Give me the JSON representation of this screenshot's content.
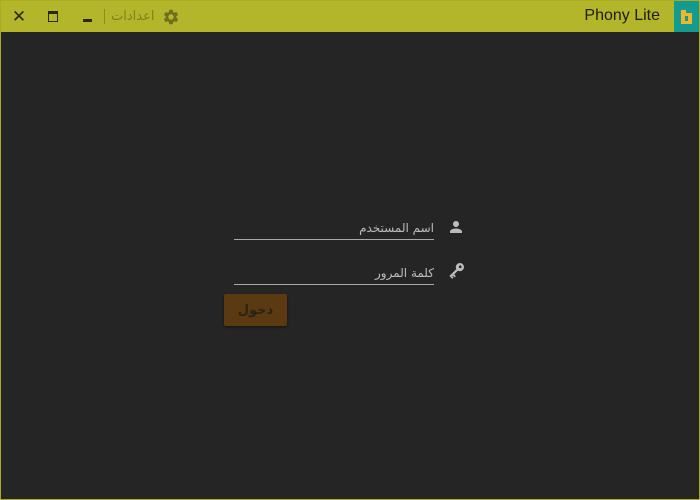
{
  "window": {
    "title": "Phony Lite",
    "settings_label": "اعدادات",
    "controls": {
      "close": "close-icon",
      "maximize": "maximize-icon",
      "minimize": "minimize-icon"
    },
    "logo_icon": "sim-card-icon"
  },
  "login": {
    "username_placeholder": "اسم المستخدم",
    "password_placeholder": "كلمة المرور",
    "username_icon": "person-icon",
    "password_icon": "key-icon",
    "submit_label": "دخول"
  },
  "colors": {
    "titlebar": "#b3b52a",
    "background": "#252525",
    "button": "#5b3a12",
    "logo_bg": "#129b8e",
    "logo_sim": "#f1b62a"
  }
}
